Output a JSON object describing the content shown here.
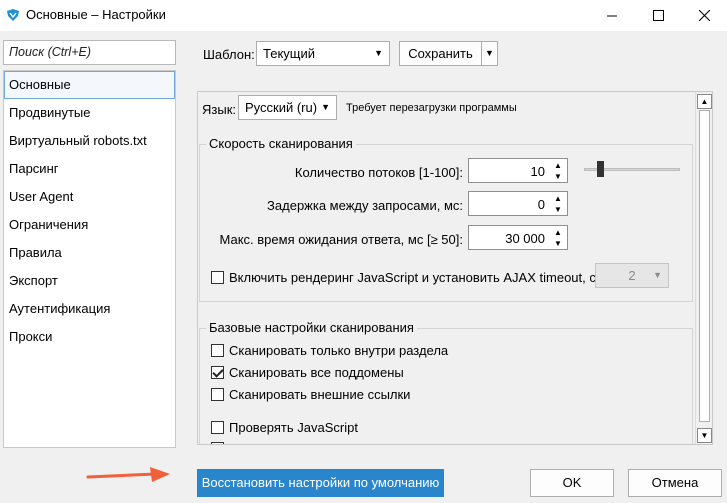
{
  "window": {
    "title": "Основные – Настройки"
  },
  "sidebar": {
    "search_placeholder": "Поиск (Ctrl+E)",
    "items": [
      {
        "label": "Основные"
      },
      {
        "label": "Продвинутые"
      },
      {
        "label": "Виртуальный robots.txt"
      },
      {
        "label": "Парсинг"
      },
      {
        "label": "User Agent"
      },
      {
        "label": "Ограничения"
      },
      {
        "label": "Правила"
      },
      {
        "label": "Экспорт"
      },
      {
        "label": "Аутентификация"
      },
      {
        "label": "Прокси"
      }
    ]
  },
  "toolbar": {
    "template_label": "Шаблон:",
    "template_value": "Текущий",
    "save_label": "Сохранить"
  },
  "language": {
    "label": "Язык:",
    "value": "Русский (ru)",
    "note": "Требует перезагрузки программы"
  },
  "speed": {
    "title": "Скорость сканирования",
    "threads_label": "Количество потоков [1-100]:",
    "threads_value": "10",
    "delay_label": "Задержка между запросами, мс:",
    "delay_value": "0",
    "timeout_label": "Макс. время ожидания ответа, мс [≥ 50]:",
    "timeout_value": "30 000",
    "js_label": "Включить рендеринг JavaScript и установить AJAX timeout, с:",
    "ajax_value": "2"
  },
  "basic": {
    "title": "Базовые настройки сканирования",
    "opt1": "Сканировать только внутри раздела",
    "opt2": "Сканировать все поддомены",
    "opt3": "Сканировать внешние ссылки",
    "opt4": "Проверять JavaScript"
  },
  "footer": {
    "reset_label": "Восстановить настройки по умолчанию",
    "ok_label": "OK",
    "cancel_label": "Отмена"
  },
  "colors": {
    "accent": "#2986cc",
    "arrow": "#f0603a"
  }
}
